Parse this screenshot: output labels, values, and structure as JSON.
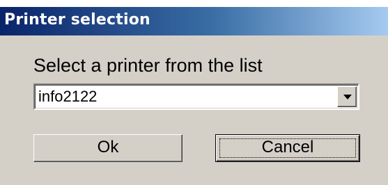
{
  "window": {
    "title": "Printer selection"
  },
  "dialog": {
    "prompt": "Select a printer from the list",
    "printer_select": {
      "value": "info2122"
    },
    "ok_label": "Ok",
    "cancel_label": "Cancel"
  },
  "colors": {
    "titlebar_start": "#0a246a",
    "titlebar_end": "#a6caf0",
    "dialog_bg": "#d4d0c8"
  },
  "icons": {
    "combo_arrow": "chevron-down-icon"
  }
}
